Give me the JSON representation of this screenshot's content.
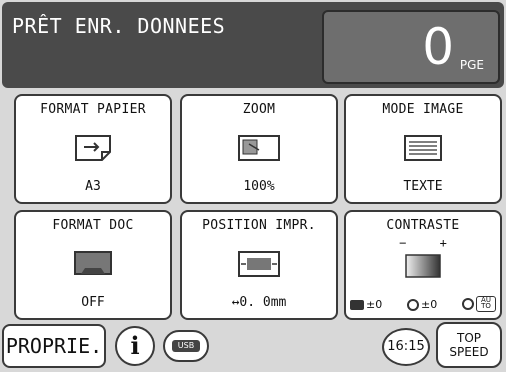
{
  "header": {
    "status": "PRÊT ENR. DONNEES",
    "counter_value": "0",
    "counter_unit": "PGE"
  },
  "tiles": {
    "format_papier": {
      "label": "FORMAT PAPIER",
      "value": "A3"
    },
    "zoom": {
      "label": "ZOOM",
      "value": "100%"
    },
    "mode_image": {
      "label": "MODE IMAGE",
      "value": "TEXTE"
    },
    "format_doc": {
      "label": "FORMAT DOC",
      "value": "OFF"
    },
    "position_impr": {
      "label": "POSITION IMPR.",
      "value": "↔0. 0mm"
    },
    "contraste": {
      "label": "CONTRASTE",
      "minus": "−",
      "plus": "+",
      "val1": "±0",
      "val2": "±0",
      "auto_label": "AU TO"
    }
  },
  "bottom": {
    "proprie": "PROPRIE.",
    "info": "i",
    "usb": "USB",
    "time": "16:15",
    "speed_line1": "TOP",
    "speed_line2": "SPEED"
  }
}
